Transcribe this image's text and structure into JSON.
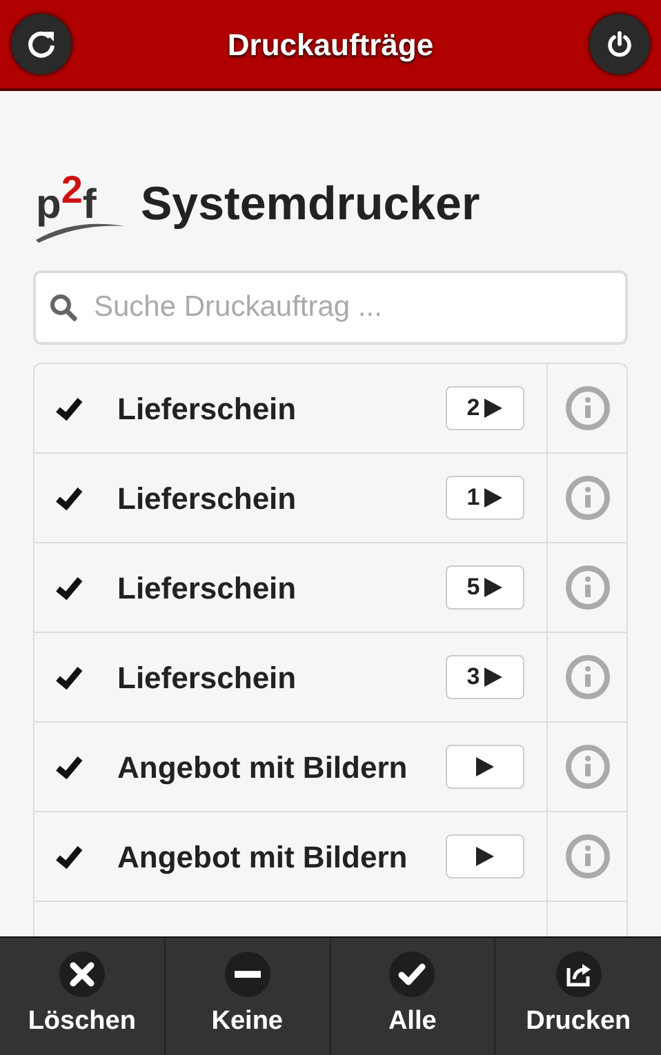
{
  "header": {
    "title": "Druckaufträge"
  },
  "logo": {
    "letters": [
      "p",
      "2",
      "f"
    ]
  },
  "heading": "Systemdrucker",
  "search": {
    "placeholder": "Suche Druckauftrag ..."
  },
  "jobs": [
    {
      "label": "Lieferschein",
      "count": "2",
      "checked": true
    },
    {
      "label": "Lieferschein",
      "count": "1",
      "checked": true
    },
    {
      "label": "Lieferschein",
      "count": "5",
      "checked": true
    },
    {
      "label": "Lieferschein",
      "count": "3",
      "checked": true
    },
    {
      "label": "Angebot mit Bildern",
      "checked": true
    },
    {
      "label": "Angebot mit Bildern",
      "checked": true
    }
  ],
  "footer": [
    {
      "kind": "delete",
      "label": "Löschen"
    },
    {
      "kind": "none",
      "label": "Keine"
    },
    {
      "kind": "all",
      "label": "Alle"
    },
    {
      "kind": "print",
      "label": "Drucken"
    }
  ]
}
